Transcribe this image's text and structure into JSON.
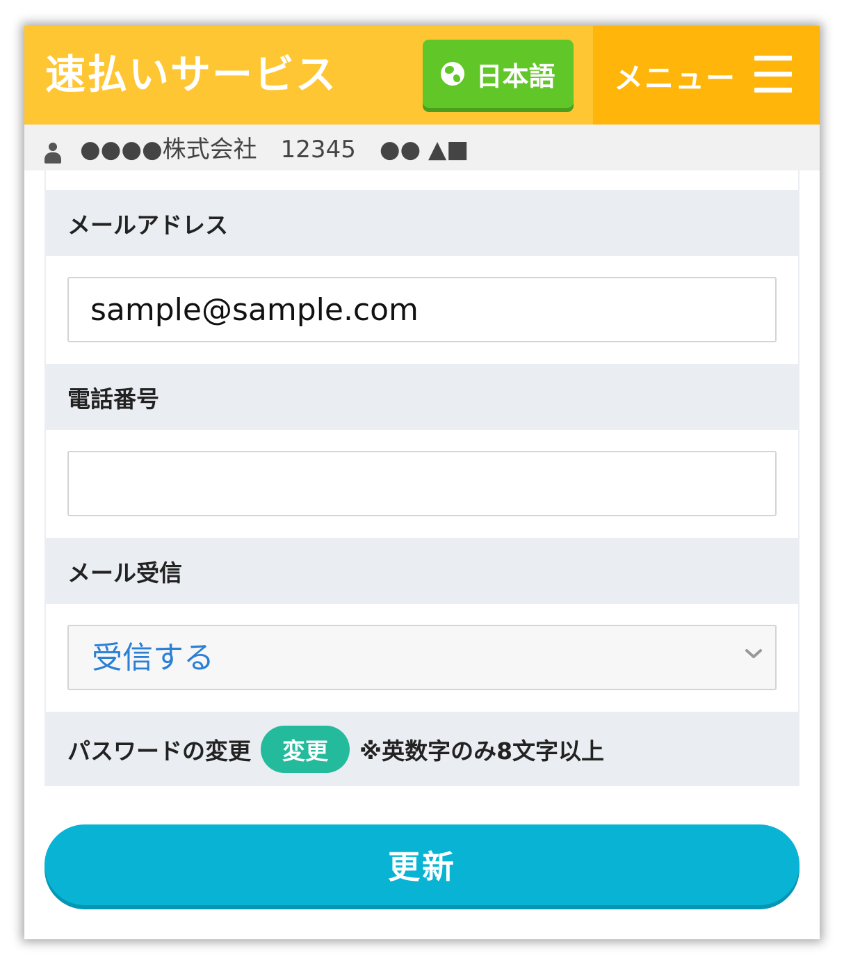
{
  "header": {
    "brand": "速払いサービス",
    "language_button": {
      "label": "日本語",
      "icon": "globe-icon"
    },
    "menu": {
      "label": "メニュー",
      "icon": "hamburger-icon"
    },
    "colors": {
      "header_bg": "#ffc633",
      "menu_bg": "#ffb50a",
      "language_bg": "#61c627"
    }
  },
  "user_bar": {
    "icon": "user-icon",
    "text": "●●●●株式会社　12345　●● ▲■"
  },
  "form": {
    "email": {
      "label": "メールアドレス",
      "value": "sample@sample.com"
    },
    "phone": {
      "label": "電話番号",
      "value": ""
    },
    "mail_receive": {
      "label": "メール受信",
      "selected": "受信する"
    },
    "password": {
      "label": "パスワードの変更",
      "change_button": "変更",
      "note": "※英数字のみ8文字以上"
    }
  },
  "update_button": {
    "label": "更新",
    "color": "#08b3d4"
  }
}
